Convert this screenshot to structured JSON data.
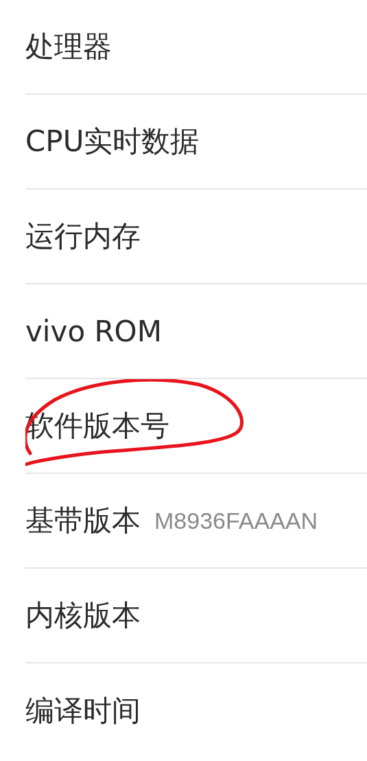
{
  "items": [
    {
      "label": "处理器",
      "annotated": false
    },
    {
      "label": "CPU实时数据",
      "annotated": false
    },
    {
      "label": "运行内存",
      "annotated": false
    },
    {
      "label": "vivo ROM",
      "annotated": false
    },
    {
      "label": "软件版本号",
      "annotated": true
    },
    {
      "label": "基带版本",
      "value": "M8936FAAAAN",
      "annotated": false
    },
    {
      "label": "内核版本",
      "annotated": false
    },
    {
      "label": "编译时间",
      "annotated": false
    }
  ]
}
